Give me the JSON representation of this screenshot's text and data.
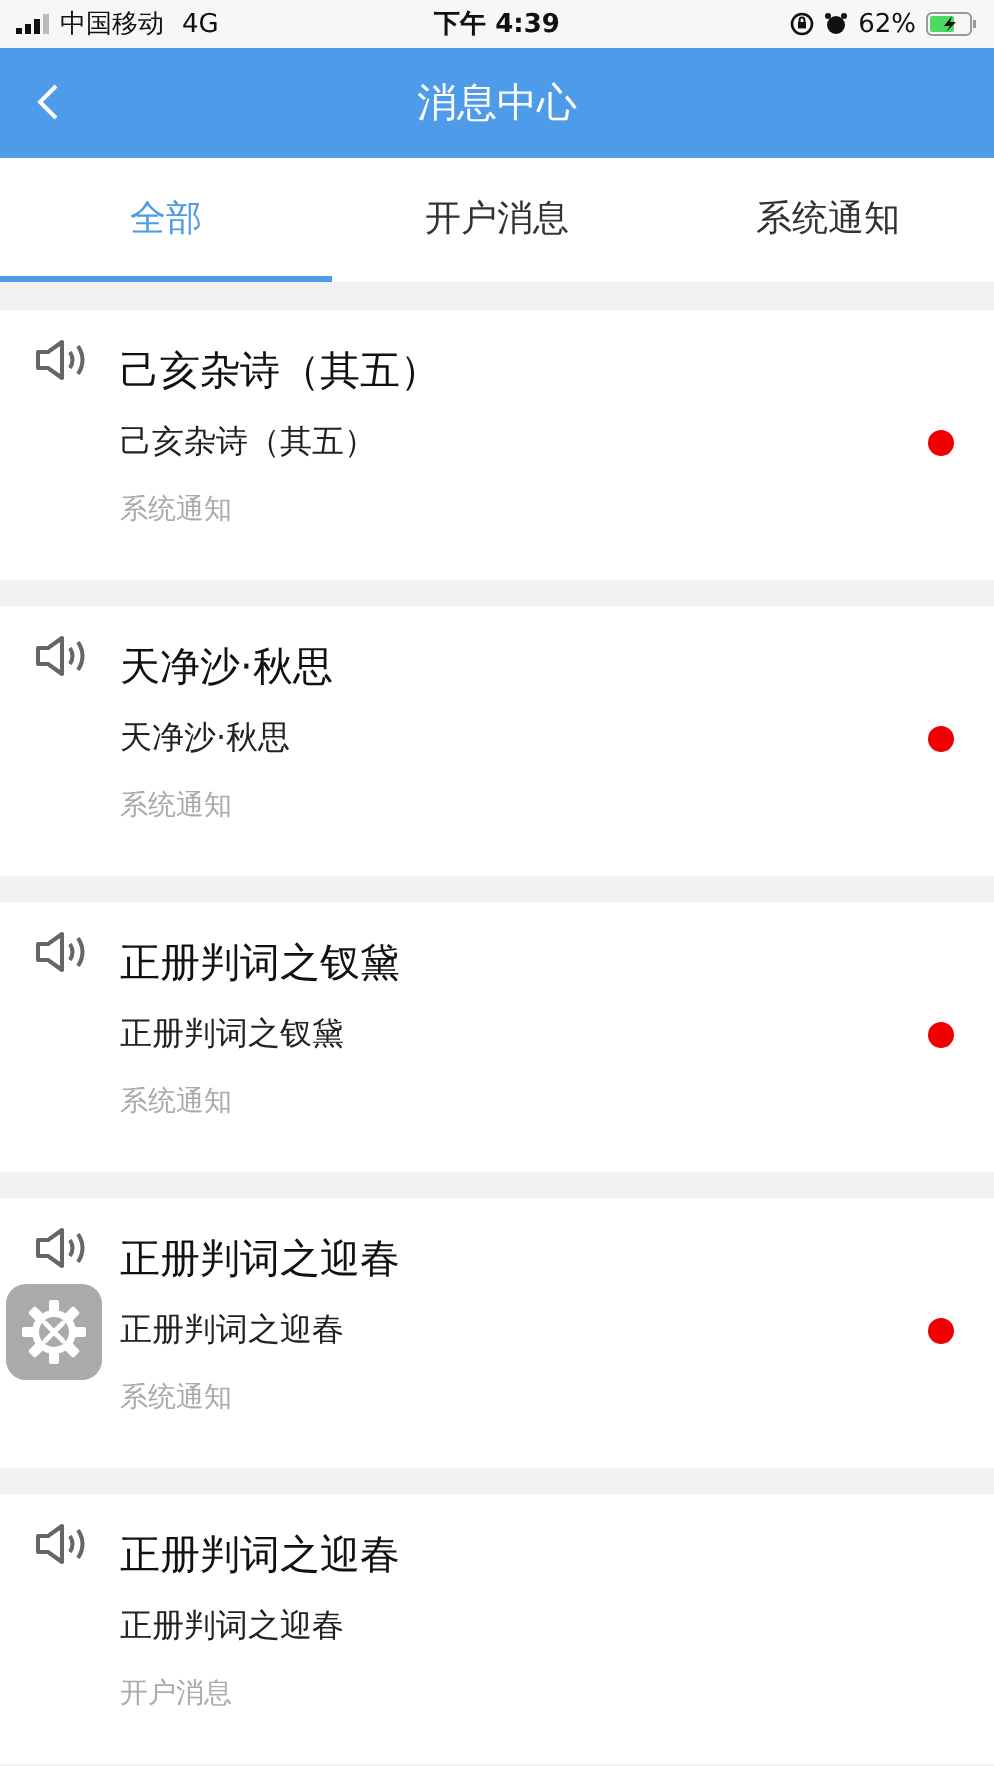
{
  "status_bar": {
    "carrier": "中国移动",
    "network": "4G",
    "time": "下午 4:39",
    "battery": "62%"
  },
  "header": {
    "title": "消息中心"
  },
  "tabs": [
    {
      "label": "全部",
      "selected": true
    },
    {
      "label": "开户消息",
      "selected": false
    },
    {
      "label": "系统通知",
      "selected": false
    }
  ],
  "messages": [
    {
      "title": "己亥杂诗（其五）",
      "body": "己亥杂诗（其五）",
      "category": "系统通知",
      "unread": true
    },
    {
      "title": "天净沙·秋思",
      "body": "天净沙·秋思",
      "category": "系统通知",
      "unread": true
    },
    {
      "title": "正册判词之钗黛",
      "body": "正册判词之钗黛",
      "category": "系统通知",
      "unread": true
    },
    {
      "title": "正册判词之迎春",
      "body": "正册判词之迎春",
      "category": "系统通知",
      "unread": true
    },
    {
      "title": "正册判词之迎春",
      "body": "正册判词之迎春",
      "category": "开户消息",
      "unread": false
    }
  ]
}
